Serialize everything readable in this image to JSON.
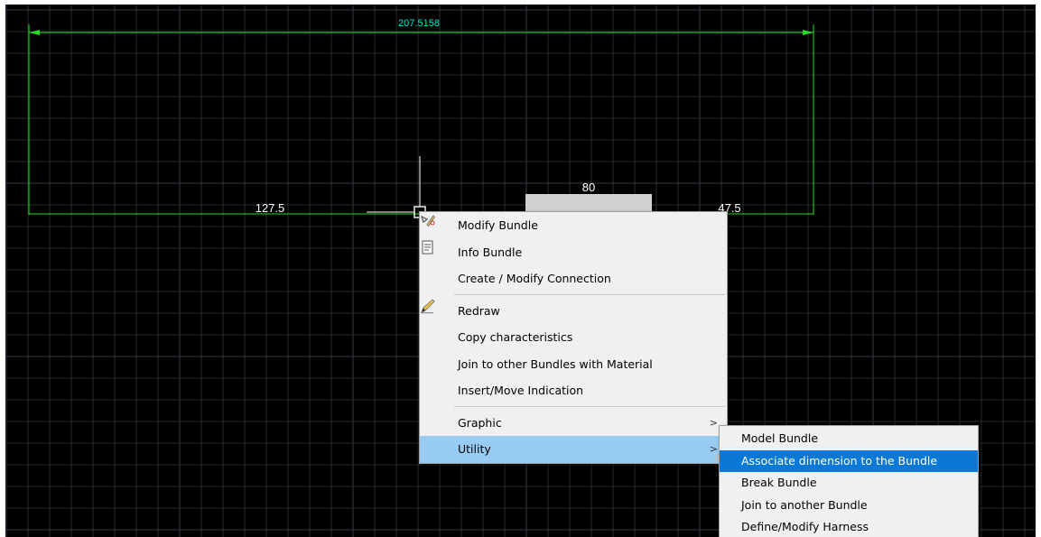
{
  "drawing": {
    "dimension_total": "207.5158",
    "dimension_left": "127.5",
    "dimension_center": "80",
    "dimension_right": "47.5",
    "colors": {
      "background": "#000000",
      "grid": "#2b2b2b",
      "grid_major": "#3a3a4a",
      "dimension_line": "#22dd22",
      "dimension_text_total": "#00e5d0",
      "dimension_text": "#ffffff",
      "crosshair": "#ffffff",
      "block": "#d0d0d0"
    }
  },
  "context_menu": {
    "items": [
      {
        "label": "Modify Bundle",
        "icon": "modify-bundle-icon"
      },
      {
        "label": "Info Bundle",
        "icon": "info-bundle-icon"
      },
      {
        "label": "Create / Modify Connection"
      },
      {
        "label": "Redraw",
        "icon": "redraw-pencil-icon"
      },
      {
        "label": "Copy characteristics"
      },
      {
        "label": "Join to other Bundles with Material"
      },
      {
        "label": "Insert/Move Indication"
      },
      {
        "label": "Graphic",
        "submenu_arrow": ">"
      },
      {
        "label": "Utility",
        "submenu_arrow": ">"
      }
    ]
  },
  "utility_submenu": {
    "items": [
      {
        "label": "Model Bundle"
      },
      {
        "label": "Associate dimension to the Bundle"
      },
      {
        "label": "Break Bundle"
      },
      {
        "label": "Join to another Bundle"
      },
      {
        "label": "Define/Modify Harness"
      }
    ]
  }
}
